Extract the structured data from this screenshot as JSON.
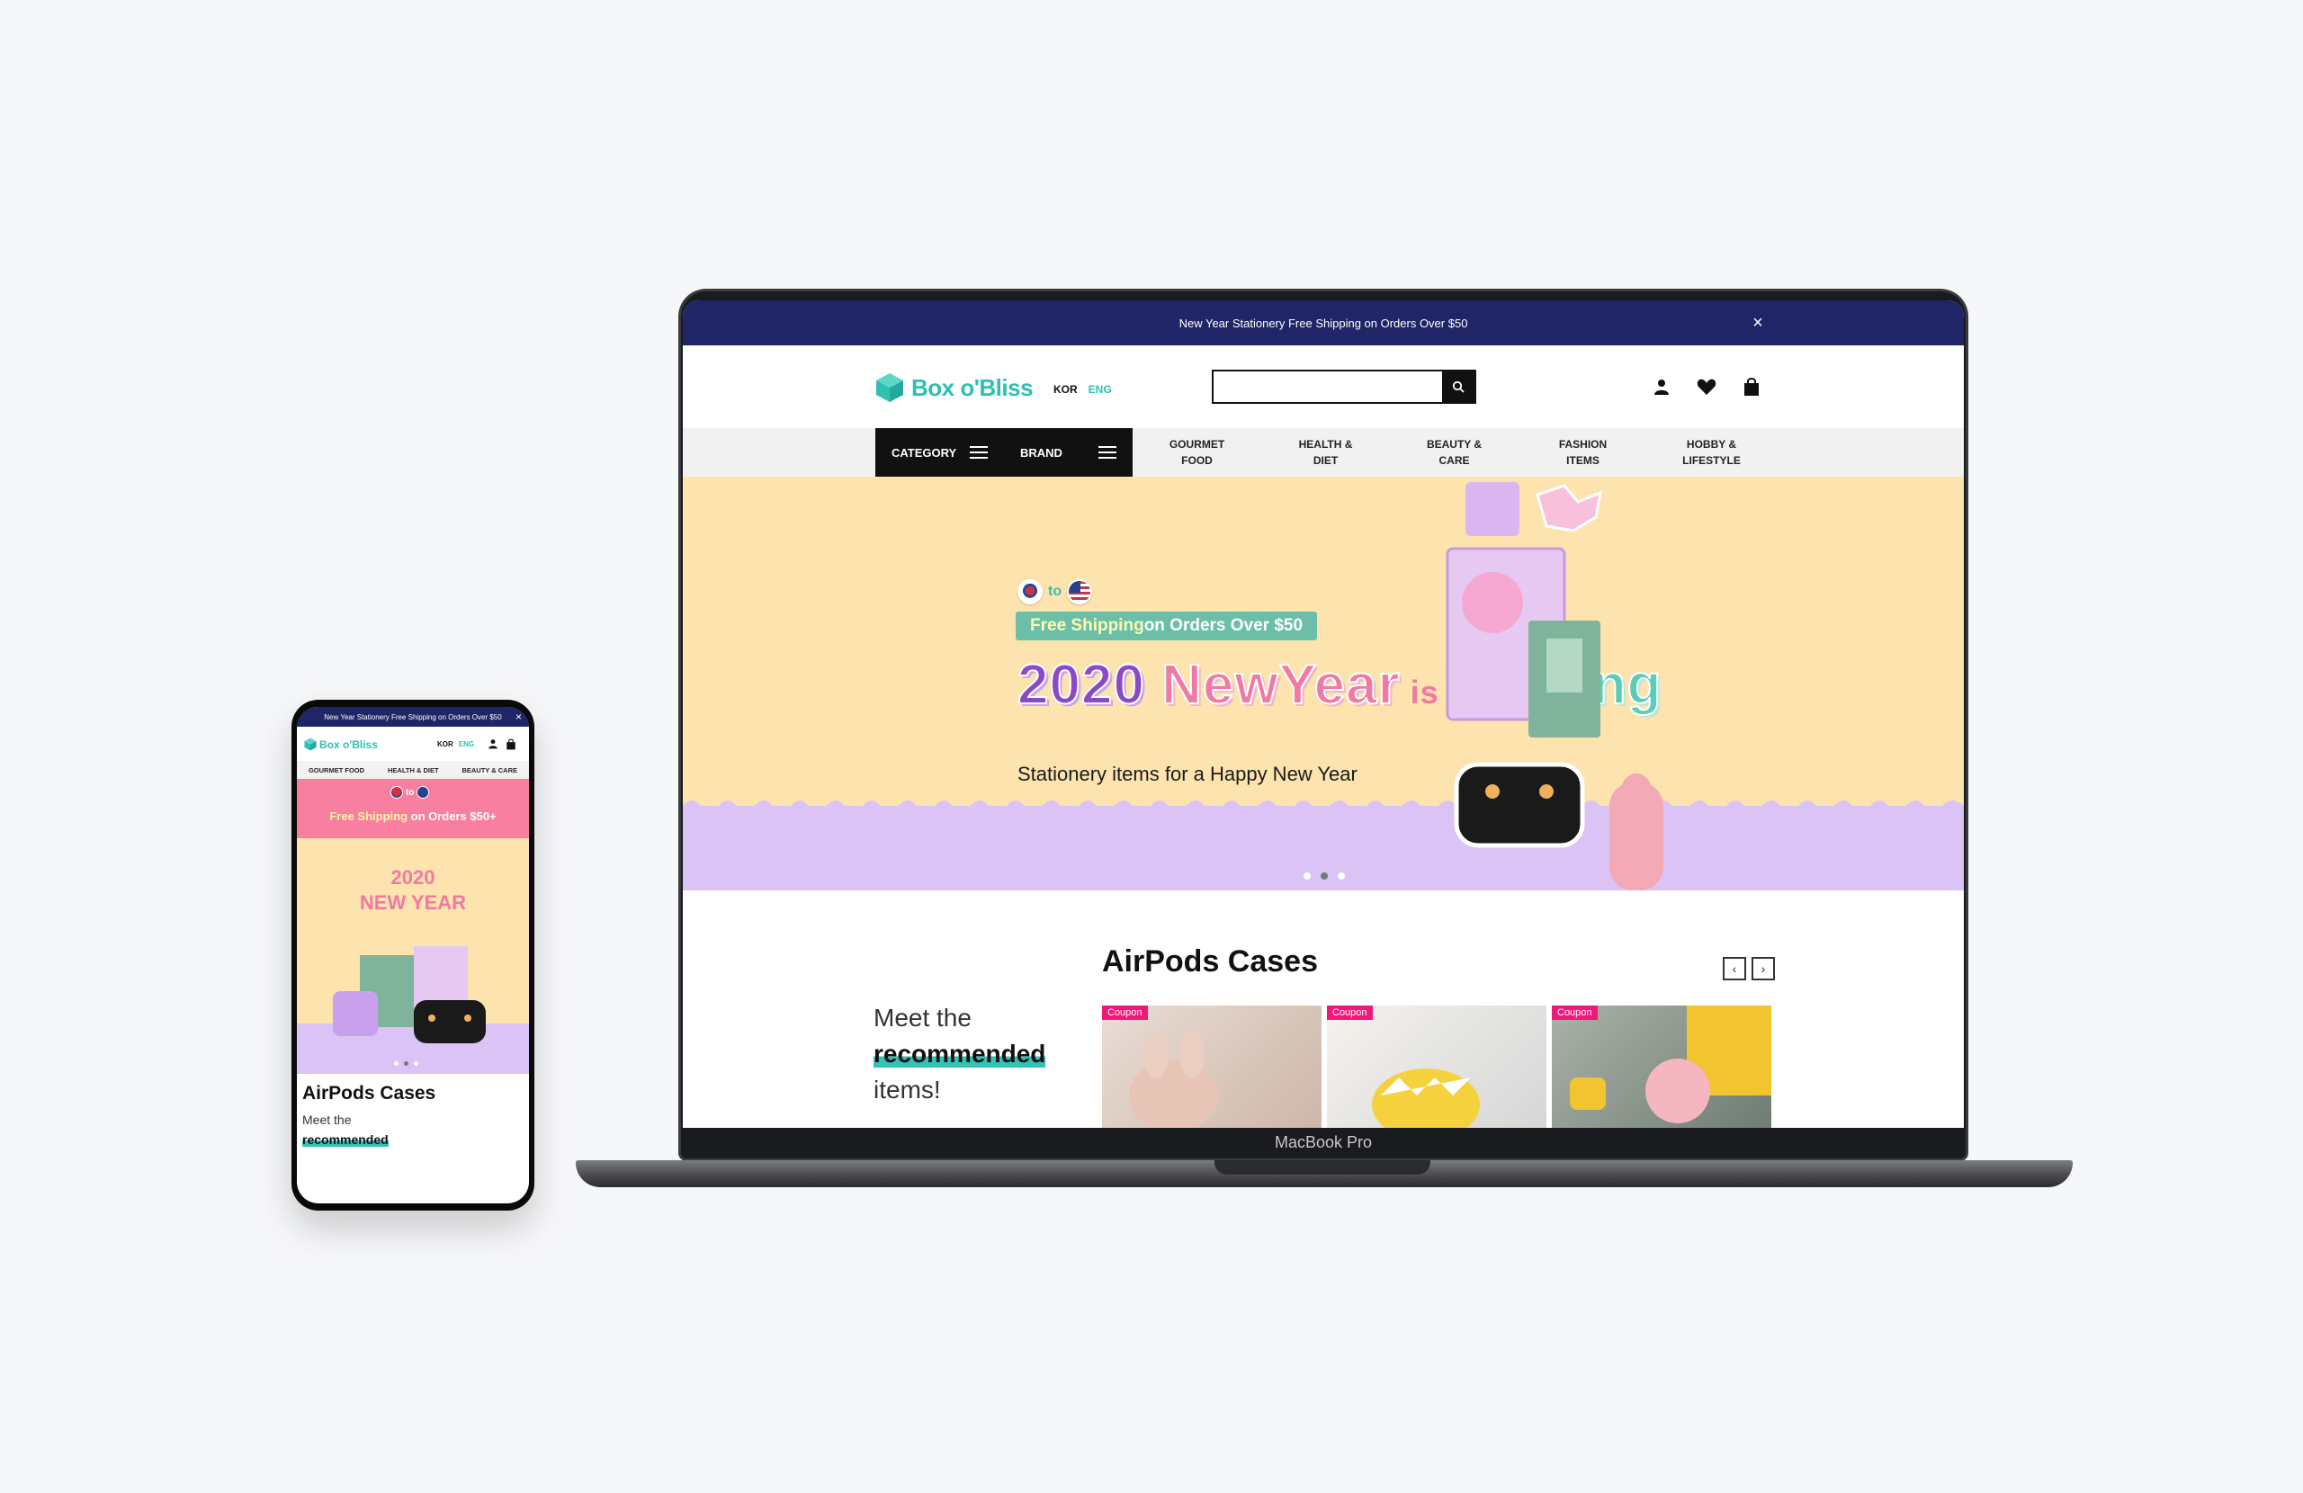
{
  "desktop": {
    "announcement": "New Year Stationery Free Shipping on Orders Over $50",
    "brand_name": "Box o'Bliss",
    "lang_kor": "KOR",
    "lang_eng": "ENG",
    "search_placeholder": "",
    "icons": [
      "user-icon",
      "heart-icon",
      "shopping-bag-icon",
      "search-icon",
      "close-icon"
    ],
    "nav": {
      "category_label": "CATEGORY",
      "brand_label": "BRAND",
      "items": [
        "GOURMET\nFOOD",
        "HEALTH &\nDIET",
        "BEAUTY &\nCARE",
        "FASHION\nITEMS",
        "HOBBY &\nLIFESTYLE"
      ]
    },
    "hero": {
      "flags_to": "to",
      "ship_highlight": "Free Shipping",
      "ship_rest": " on Orders Over $50",
      "title_2020": "2020 ",
      "title_newyear": "NewYear",
      "title_is": " is ",
      "title_coming": "Coming",
      "subtitle": "Stationery items for a Happy New Year",
      "slides": 3,
      "active_slide": 2
    },
    "recommended": {
      "meet_line1": "Meet the",
      "meet_highlight": "recommended",
      "meet_line3": "items!",
      "section_title": "AirPods Cases",
      "prev_arrow": "‹",
      "next_arrow": "›",
      "cards": [
        {
          "badge": "Coupon"
        },
        {
          "badge": "Coupon"
        },
        {
          "badge": "Coupon"
        }
      ]
    },
    "device_label": "MacBook Pro"
  },
  "mobile": {
    "announcement": "New Year Stationery Free Shipping on Orders Over $50",
    "brand_name": "Box o'Bliss",
    "lang_kor": "KOR",
    "lang_eng": "ENG",
    "nav_items": [
      "GOURMET FOOD",
      "HEALTH & DIET",
      "BEAUTY & CARE"
    ],
    "promo_to": "to",
    "promo_highlight": "Free Shipping",
    "promo_rest": " on Orders $50+",
    "hero_line1": "2020",
    "hero_line2": "NEW YEAR",
    "section_title": "AirPods Cases",
    "meet_line1": "Meet the",
    "meet_highlight": "recommended"
  },
  "colors": {
    "navy": "#1f2566",
    "teal": "#2fbfb3",
    "peach": "#fde3ae",
    "lavender": "#dcc3f5",
    "pink": "#f07aa3",
    "coupon": "#ee1a7a"
  }
}
